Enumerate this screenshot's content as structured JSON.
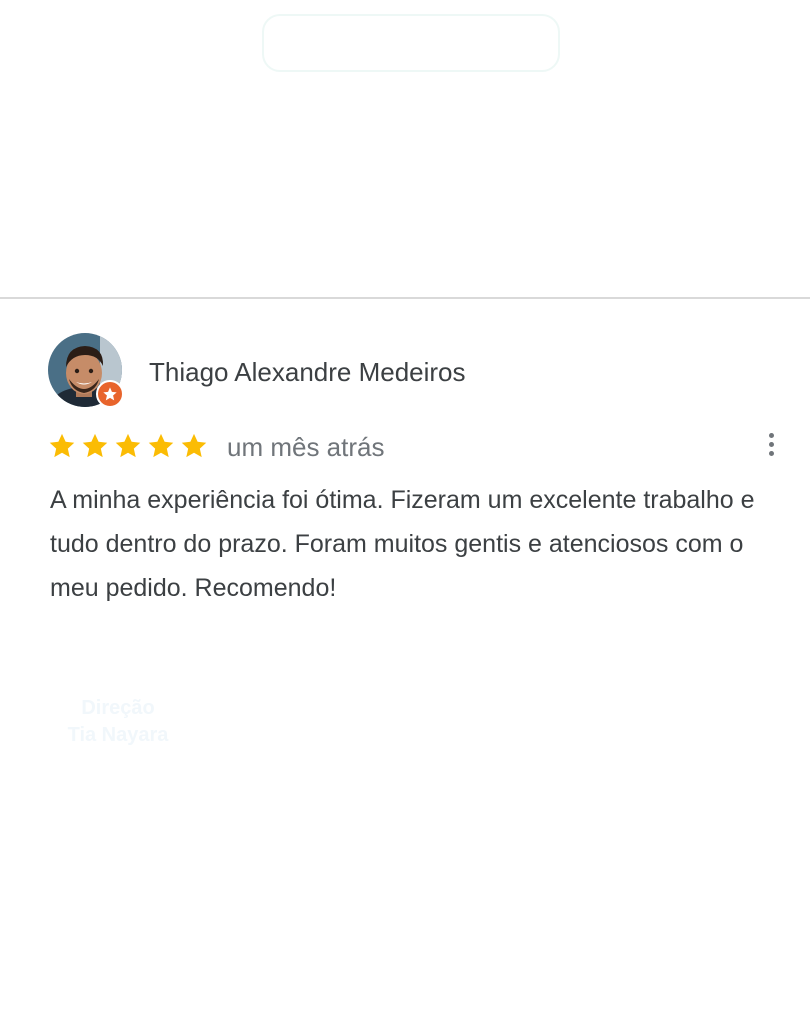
{
  "review": {
    "author": "Thiago Alexandre Medeiros",
    "rating": 5,
    "rating_max": 5,
    "date": "um mês atrás",
    "text": "A minha experiência foi ótima. Fizeram um excelente trabalho e tudo dentro do prazo. Foram muitos gentis e atenciosos com o meu pedido. Recomendo!",
    "star_color": "#fbbc04",
    "badge_color": "#e8642c"
  },
  "faint_caption": {
    "line1": "Direção",
    "line2": "Tia Nayara"
  },
  "icons": [
    "star-icon",
    "local-guide-badge-icon",
    "more-options-icon",
    "avatar"
  ]
}
